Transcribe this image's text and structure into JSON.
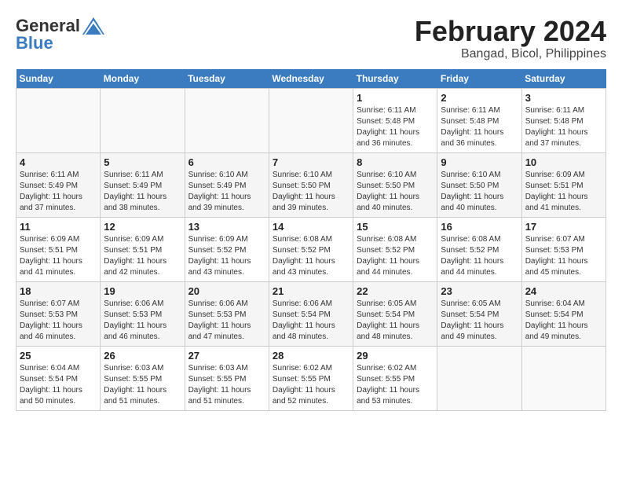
{
  "header": {
    "logo_general": "General",
    "logo_blue": "Blue",
    "title": "February 2024",
    "subtitle": "Bangad, Bicol, Philippines"
  },
  "days_of_week": [
    "Sunday",
    "Monday",
    "Tuesday",
    "Wednesday",
    "Thursday",
    "Friday",
    "Saturday"
  ],
  "weeks": [
    [
      {
        "day": "",
        "empty": true
      },
      {
        "day": "",
        "empty": true
      },
      {
        "day": "",
        "empty": true
      },
      {
        "day": "",
        "empty": true
      },
      {
        "day": "1",
        "sunrise": "6:11 AM",
        "sunset": "5:48 PM",
        "daylight": "11 hours and 36 minutes."
      },
      {
        "day": "2",
        "sunrise": "6:11 AM",
        "sunset": "5:48 PM",
        "daylight": "11 hours and 36 minutes."
      },
      {
        "day": "3",
        "sunrise": "6:11 AM",
        "sunset": "5:48 PM",
        "daylight": "11 hours and 37 minutes."
      }
    ],
    [
      {
        "day": "4",
        "sunrise": "6:11 AM",
        "sunset": "5:49 PM",
        "daylight": "11 hours and 37 minutes."
      },
      {
        "day": "5",
        "sunrise": "6:11 AM",
        "sunset": "5:49 PM",
        "daylight": "11 hours and 38 minutes."
      },
      {
        "day": "6",
        "sunrise": "6:10 AM",
        "sunset": "5:49 PM",
        "daylight": "11 hours and 39 minutes."
      },
      {
        "day": "7",
        "sunrise": "6:10 AM",
        "sunset": "5:50 PM",
        "daylight": "11 hours and 39 minutes."
      },
      {
        "day": "8",
        "sunrise": "6:10 AM",
        "sunset": "5:50 PM",
        "daylight": "11 hours and 40 minutes."
      },
      {
        "day": "9",
        "sunrise": "6:10 AM",
        "sunset": "5:50 PM",
        "daylight": "11 hours and 40 minutes."
      },
      {
        "day": "10",
        "sunrise": "6:09 AM",
        "sunset": "5:51 PM",
        "daylight": "11 hours and 41 minutes."
      }
    ],
    [
      {
        "day": "11",
        "sunrise": "6:09 AM",
        "sunset": "5:51 PM",
        "daylight": "11 hours and 41 minutes."
      },
      {
        "day": "12",
        "sunrise": "6:09 AM",
        "sunset": "5:51 PM",
        "daylight": "11 hours and 42 minutes."
      },
      {
        "day": "13",
        "sunrise": "6:09 AM",
        "sunset": "5:52 PM",
        "daylight": "11 hours and 43 minutes."
      },
      {
        "day": "14",
        "sunrise": "6:08 AM",
        "sunset": "5:52 PM",
        "daylight": "11 hours and 43 minutes."
      },
      {
        "day": "15",
        "sunrise": "6:08 AM",
        "sunset": "5:52 PM",
        "daylight": "11 hours and 44 minutes."
      },
      {
        "day": "16",
        "sunrise": "6:08 AM",
        "sunset": "5:52 PM",
        "daylight": "11 hours and 44 minutes."
      },
      {
        "day": "17",
        "sunrise": "6:07 AM",
        "sunset": "5:53 PM",
        "daylight": "11 hours and 45 minutes."
      }
    ],
    [
      {
        "day": "18",
        "sunrise": "6:07 AM",
        "sunset": "5:53 PM",
        "daylight": "11 hours and 46 minutes."
      },
      {
        "day": "19",
        "sunrise": "6:06 AM",
        "sunset": "5:53 PM",
        "daylight": "11 hours and 46 minutes."
      },
      {
        "day": "20",
        "sunrise": "6:06 AM",
        "sunset": "5:53 PM",
        "daylight": "11 hours and 47 minutes."
      },
      {
        "day": "21",
        "sunrise": "6:06 AM",
        "sunset": "5:54 PM",
        "daylight": "11 hours and 48 minutes."
      },
      {
        "day": "22",
        "sunrise": "6:05 AM",
        "sunset": "5:54 PM",
        "daylight": "11 hours and 48 minutes."
      },
      {
        "day": "23",
        "sunrise": "6:05 AM",
        "sunset": "5:54 PM",
        "daylight": "11 hours and 49 minutes."
      },
      {
        "day": "24",
        "sunrise": "6:04 AM",
        "sunset": "5:54 PM",
        "daylight": "11 hours and 49 minutes."
      }
    ],
    [
      {
        "day": "25",
        "sunrise": "6:04 AM",
        "sunset": "5:54 PM",
        "daylight": "11 hours and 50 minutes."
      },
      {
        "day": "26",
        "sunrise": "6:03 AM",
        "sunset": "5:55 PM",
        "daylight": "11 hours and 51 minutes."
      },
      {
        "day": "27",
        "sunrise": "6:03 AM",
        "sunset": "5:55 PM",
        "daylight": "11 hours and 51 minutes."
      },
      {
        "day": "28",
        "sunrise": "6:02 AM",
        "sunset": "5:55 PM",
        "daylight": "11 hours and 52 minutes."
      },
      {
        "day": "29",
        "sunrise": "6:02 AM",
        "sunset": "5:55 PM",
        "daylight": "11 hours and 53 minutes."
      },
      {
        "day": "",
        "empty": true
      },
      {
        "day": "",
        "empty": true
      }
    ]
  ]
}
